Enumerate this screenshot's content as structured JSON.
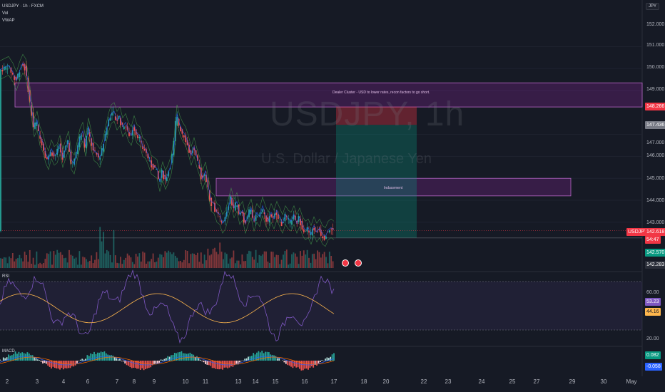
{
  "header": {
    "symbol_line": "USDJPY · 1h · FXCM",
    "indicator_vol": "Vol",
    "indicator_vwap": "VWAP",
    "currency": "JPY"
  },
  "watermark": {
    "ticker": "USDJPY, 1h",
    "name": "U.S. Dollar / Japanese Yen"
  },
  "annotations": {
    "dealer_cluster": "Dealer Cluster - USD to lower rates, recon factors to go short.",
    "inducement": "Inducement"
  },
  "price_axis": {
    "ticks": [
      "152.000",
      "151.000",
      "150.000",
      "149.000",
      "147.000",
      "146.000",
      "145.000",
      "144.000",
      "143.000"
    ],
    "badges": {
      "target": "148.266",
      "entry": "147.436",
      "symbol": "USDJPY",
      "last": "142.618",
      "countdown": "54:47",
      "stop": "142.570",
      "low": "142.283"
    }
  },
  "rsi": {
    "label": "RSI",
    "tick_60": "60.00",
    "tick_20": "20.00",
    "rsi_value": "53.23",
    "ma_value": "44.16"
  },
  "macd": {
    "label": "MACD",
    "macd_value": "0.082",
    "signal_value": "-0.058"
  },
  "time_axis": [
    "2",
    "3",
    "4",
    "6",
    "7",
    "8",
    "9",
    "10",
    "11",
    "13",
    "14",
    "15",
    "16",
    "17",
    "18",
    "20",
    "22",
    "23",
    "24",
    "25",
    "27",
    "29",
    "30",
    "May"
  ],
  "colors": {
    "up": "#26a69a",
    "down": "#ef5350",
    "purple": "#9c27b0",
    "rsi_line": "#7e57c2",
    "rsi_ma": "#ffb74d",
    "macd_line": "#2962ff",
    "signal_line": "#ff6d00",
    "badge_target": "#f23645",
    "badge_entry": "#787b86",
    "badge_stop": "#089981"
  },
  "chart_data": {
    "type": "candlestick",
    "symbol": "USDJPY",
    "interval": "1h",
    "ylim": [
      142.2,
      152.3
    ],
    "price_path": [
      [
        0,
        149.9
      ],
      [
        6,
        150.0
      ],
      [
        12,
        150.1
      ],
      [
        18,
        149.8
      ],
      [
        23,
        149.4
      ],
      [
        28,
        149.9
      ],
      [
        32,
        150.2
      ],
      [
        36,
        150.0
      ],
      [
        40,
        149.2
      ],
      [
        44,
        148.2
      ],
      [
        48,
        147.3
      ],
      [
        52,
        147.6
      ],
      [
        56,
        146.9
      ],
      [
        60,
        146.6
      ],
      [
        64,
        146.1
      ],
      [
        68,
        145.8
      ],
      [
        72,
        146.3
      ],
      [
        76,
        146.0
      ],
      [
        80,
        146.1
      ],
      [
        84,
        146.5
      ],
      [
        88,
        145.9
      ],
      [
        92,
        146.3
      ],
      [
        96,
        146.7
      ],
      [
        100,
        145.8
      ],
      [
        104,
        145.6
      ],
      [
        108,
        146.2
      ],
      [
        112,
        146.8
      ],
      [
        116,
        147.1
      ],
      [
        120,
        146.4
      ],
      [
        124,
        147.3
      ],
      [
        128,
        146.7
      ],
      [
        132,
        146.2
      ],
      [
        136,
        146.1
      ],
      [
        140,
        145.9
      ],
      [
        144,
        146.3
      ],
      [
        148,
        146.9
      ],
      [
        152,
        147.5
      ],
      [
        156,
        147.9
      ],
      [
        160,
        148.0
      ],
      [
        164,
        147.6
      ],
      [
        168,
        147.8
      ],
      [
        172,
        147.3
      ],
      [
        176,
        147.5
      ],
      [
        180,
        147.1
      ],
      [
        184,
        146.9
      ],
      [
        188,
        147.4
      ],
      [
        192,
        147.0
      ],
      [
        196,
        146.9
      ],
      [
        200,
        146.4
      ],
      [
        204,
        146.3
      ],
      [
        208,
        146.0
      ],
      [
        212,
        145.6
      ],
      [
        216,
        145.5
      ],
      [
        220,
        145.4
      ],
      [
        224,
        144.8
      ],
      [
        228,
        145.3
      ],
      [
        232,
        144.9
      ],
      [
        236,
        145.2
      ],
      [
        240,
        145.6
      ],
      [
        244,
        146.4
      ],
      [
        248,
        147.9
      ],
      [
        252,
        147.4
      ],
      [
        256,
        147.1
      ],
      [
        260,
        146.9
      ],
      [
        264,
        146.5
      ],
      [
        268,
        146.0
      ],
      [
        272,
        146.4
      ],
      [
        276,
        145.9
      ],
      [
        280,
        145.5
      ],
      [
        284,
        144.9
      ],
      [
        288,
        145.3
      ],
      [
        292,
        144.6
      ],
      [
        296,
        143.9
      ],
      [
        300,
        143.8
      ],
      [
        304,
        143.4
      ],
      [
        308,
        143.3
      ],
      [
        312,
        142.9
      ],
      [
        316,
        143.1
      ],
      [
        320,
        143.6
      ],
      [
        324,
        144.1
      ],
      [
        328,
        143.6
      ],
      [
        332,
        143.9
      ],
      [
        336,
        143.3
      ],
      [
        340,
        143.5
      ],
      [
        344,
        142.9
      ],
      [
        348,
        143.3
      ],
      [
        352,
        143.6
      ],
      [
        356,
        143.0
      ],
      [
        360,
        143.4
      ],
      [
        364,
        143.2
      ],
      [
        368,
        143.7
      ],
      [
        372,
        143.3
      ],
      [
        376,
        143.0
      ],
      [
        380,
        143.4
      ],
      [
        384,
        143.1
      ],
      [
        388,
        143.5
      ],
      [
        392,
        143.2
      ],
      [
        396,
        142.9
      ],
      [
        400,
        143.3
      ],
      [
        404,
        143.1
      ],
      [
        408,
        143.0
      ],
      [
        412,
        143.3
      ],
      [
        416,
        142.9
      ],
      [
        420,
        143.2
      ],
      [
        424,
        142.8
      ],
      [
        428,
        142.6
      ],
      [
        432,
        142.7
      ],
      [
        436,
        142.4
      ],
      [
        440,
        142.8
      ],
      [
        444,
        142.5
      ],
      [
        448,
        142.7
      ],
      [
        452,
        142.4
      ],
      [
        456,
        142.3
      ],
      [
        460,
        142.6
      ],
      [
        464,
        142.7
      ],
      [
        468,
        142.6
      ]
    ],
    "zones": [
      {
        "label": "Dealer Cluster - USD to lower rates, recon factors to go short.",
        "price_top": 149.35,
        "price_bottom": 148.25
      },
      {
        "label": "Inducement",
        "price_top": 145.0,
        "price_bottom": 144.2
      }
    ],
    "position": {
      "type": "short",
      "entry": 147.436,
      "stop": 148.266,
      "target": 142.283
    },
    "last_price": 142.618,
    "rsi": {
      "value": 53.23,
      "ma": 44.16,
      "levels": [
        70,
        30
      ]
    },
    "macd": {
      "macd": 0.082,
      "signal": -0.058
    }
  }
}
